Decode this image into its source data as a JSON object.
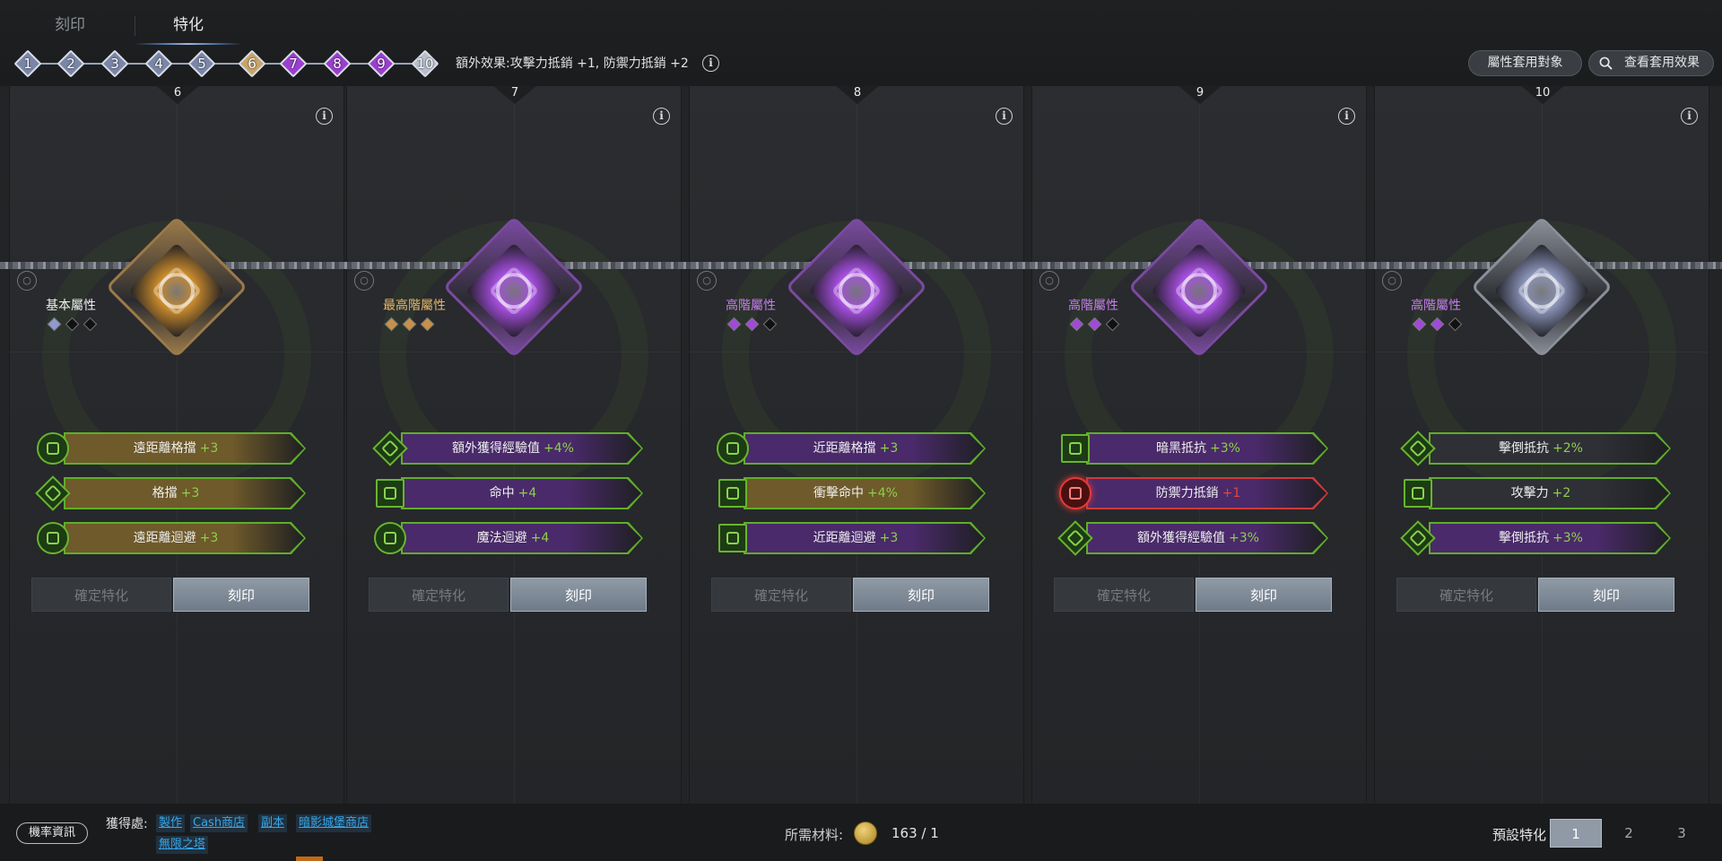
{
  "tabs": [
    "刻印",
    "特化"
  ],
  "active_tab": 1,
  "steps": [
    {
      "n": "1",
      "color": "#7a86a8"
    },
    {
      "n": "2",
      "color": "#7a86a8"
    },
    {
      "n": "3",
      "color": "#7a86a8"
    },
    {
      "n": "4",
      "color": "#7a86a8"
    },
    {
      "n": "5",
      "color": "#7a86a8"
    },
    {
      "n": "6",
      "color": "#c8a46a"
    },
    {
      "n": "7",
      "color": "#9a3fd0"
    },
    {
      "n": "8",
      "color": "#9a3fd0"
    },
    {
      "n": "9",
      "color": "#9a3fd0"
    },
    {
      "n": "10",
      "color": "#b8bfcc"
    }
  ],
  "extra_effect": "額外效果:攻擊力抵銷 +1, 防禦力抵銷 +2",
  "buttons": {
    "targets": "屬性套用對象",
    "effects": "查看套用效果"
  },
  "panels": [
    {
      "number": "6",
      "tier": "基本屬性",
      "tier_color": "#f0f0f0",
      "gems": [
        "#8f9bd0",
        "#111",
        "#111"
      ],
      "emblem_color": "#c98a2c",
      "emblem_frame": "#9b7a4a",
      "stats": [
        {
          "label": "遠距離格擋",
          "value": "+3",
          "bg": "#6e5a2a",
          "icon": "round"
        },
        {
          "label": "格擋",
          "value": "+3",
          "bg": "#6e5a2a",
          "icon": "diamond"
        },
        {
          "label": "遠距離迴避",
          "value": "+3",
          "bg": "#6e5a2a",
          "icon": "round"
        }
      ],
      "confirm": "確定特化",
      "engrave": "刻印"
    },
    {
      "number": "7",
      "tier": "最高階屬性",
      "tier_color": "#e7b76a",
      "gems": [
        "#c8914a",
        "#c8914a",
        "#c8914a"
      ],
      "emblem_color": "#a64ee0",
      "emblem_frame": "#7a4aa0",
      "stats": [
        {
          "label": "額外獲得經驗值",
          "value": "+4%",
          "bg": "#4a2a6a",
          "icon": "diamond"
        },
        {
          "label": "命中",
          "value": "+4",
          "bg": "#4a2a6a",
          "icon": "square"
        },
        {
          "label": "魔法迴避",
          "value": "+4",
          "bg": "#4a2a6a",
          "icon": "round"
        }
      ],
      "confirm": "確定特化",
      "engrave": "刻印"
    },
    {
      "number": "8",
      "tier": "高階屬性",
      "tier_color": "#c77ef0",
      "gems": [
        "#a04ad8",
        "#a04ad8",
        "#111"
      ],
      "emblem_color": "#a64ee0",
      "emblem_frame": "#7a4aa0",
      "stats": [
        {
          "label": "近距離格擋",
          "value": "+3",
          "bg": "#4a2a6a",
          "icon": "round"
        },
        {
          "label": "衝擊命中",
          "value": "+4%",
          "bg": "#6e5a2a",
          "icon": "square"
        },
        {
          "label": "近距離迴避",
          "value": "+3",
          "bg": "#4a2a6a",
          "icon": "square"
        }
      ],
      "confirm": "確定特化",
      "engrave": "刻印"
    },
    {
      "number": "9",
      "tier": "高階屬性",
      "tier_color": "#c77ef0",
      "gems": [
        "#a04ad8",
        "#a04ad8",
        "#111"
      ],
      "emblem_color": "#a64ee0",
      "emblem_frame": "#7a4aa0",
      "stats": [
        {
          "label": "暗黑抵抗",
          "value": "+3%",
          "bg": "#4a2a6a",
          "icon": "square"
        },
        {
          "label": "防禦力抵銷",
          "value": "+1",
          "bg": "#4a2a6a",
          "icon": "round-red"
        },
        {
          "label": "額外獲得經驗值",
          "value": "+3%",
          "bg": "#4a2a6a",
          "icon": "diamond"
        }
      ],
      "confirm": "確定特化",
      "engrave": "刻印"
    },
    {
      "number": "10",
      "tier": "高階屬性",
      "tier_color": "#c77ef0",
      "gems": [
        "#a04ad8",
        "#a04ad8",
        "#111"
      ],
      "emblem_color": "#8a93b8",
      "emblem_frame": "#8a8f99",
      "stats": [
        {
          "label": "擊倒抵抗",
          "value": "+2%",
          "bg": "#2e3036",
          "icon": "diamond"
        },
        {
          "label": "攻擊力",
          "value": "+2",
          "bg": "#2e3036",
          "icon": "square"
        },
        {
          "label": "擊倒抵抗",
          "value": "+3%",
          "bg": "#4a2a6a",
          "icon": "diamond"
        }
      ],
      "confirm": "確定特化",
      "engrave": "刻印"
    }
  ],
  "footer": {
    "prob_info": "機率資訊",
    "obtain_label": "獲得處:",
    "links": [
      "製作",
      "Cash商店",
      "副本",
      "暗影城堡商店",
      "無限之塔"
    ],
    "material_label": "所需材料:",
    "material_count": "163 / 1",
    "preset_label": "預設特化",
    "presets": [
      "1",
      "2",
      "3"
    ],
    "active_preset": "1"
  }
}
